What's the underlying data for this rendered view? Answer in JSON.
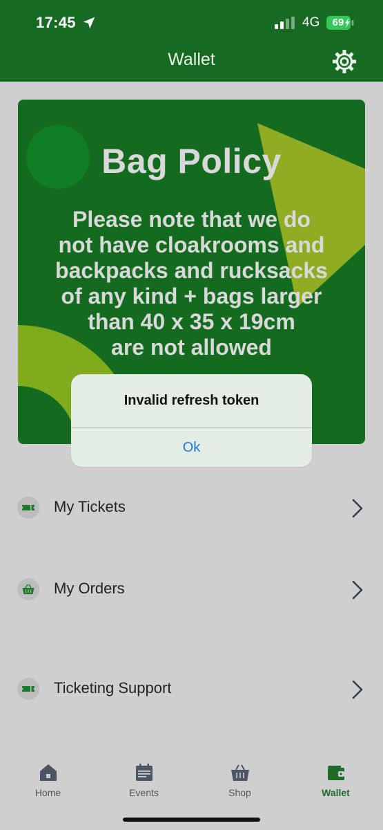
{
  "status_bar": {
    "time": "17:45",
    "network": "4G",
    "battery": "69"
  },
  "header": {
    "title": "Wallet",
    "settings_icon": "gear-icon"
  },
  "banner": {
    "title": "Bag Policy",
    "lines": [
      "Please note that we do",
      "not have cloakrooms and",
      "backpacks and rucksacks",
      "of any kind + bags larger",
      "than 40 x 35 x 19cm",
      "are not allowed"
    ]
  },
  "alert": {
    "message": "Invalid refresh token",
    "ok_label": "Ok"
  },
  "menu": [
    {
      "label": "My Tickets",
      "icon": "ticket-icon"
    },
    {
      "label": "My Orders",
      "icon": "basket-icon"
    },
    {
      "label": "Ticketing Support",
      "icon": "ticket-icon"
    }
  ],
  "tabs": [
    {
      "label": "Home",
      "icon": "home-icon"
    },
    {
      "label": "Events",
      "icon": "calendar-icon"
    },
    {
      "label": "Shop",
      "icon": "basket-icon"
    },
    {
      "label": "Wallet",
      "icon": "wallet-icon",
      "active": true
    }
  ],
  "colors": {
    "header": "#176a22",
    "banner": "#146b1f",
    "accent": "#1877e6",
    "background": "#cfcfcf"
  }
}
